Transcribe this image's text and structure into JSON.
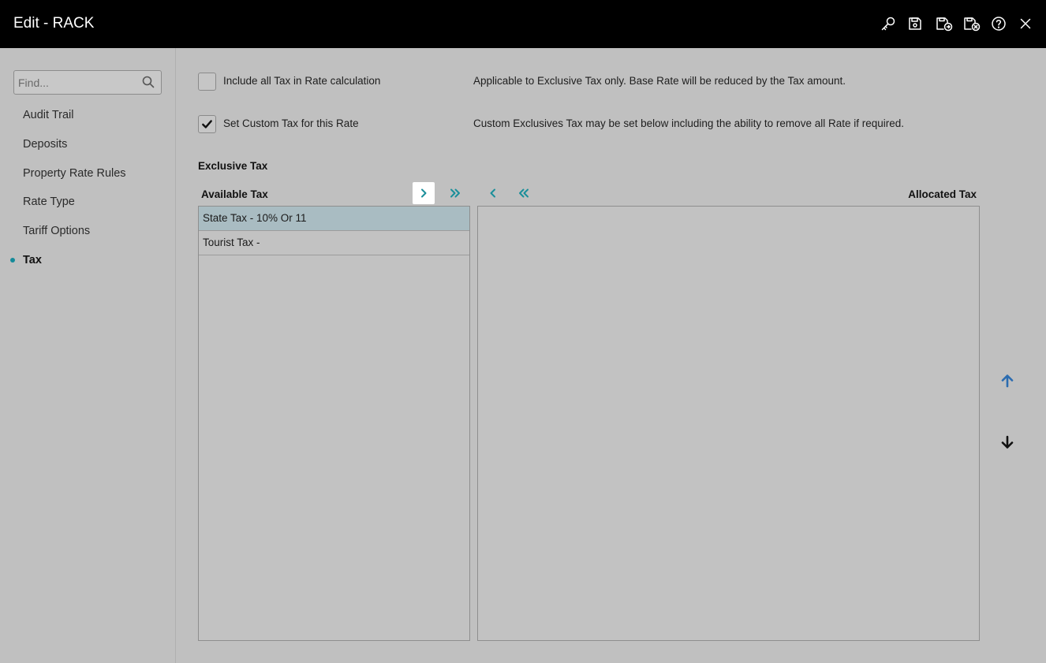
{
  "window": {
    "title": "Edit - RACK"
  },
  "toolbar_icons": [
    "key-icon",
    "save-icon",
    "save-exit-icon",
    "save-close-icon",
    "help-icon",
    "close-icon"
  ],
  "sidebar": {
    "search_placeholder": "Find...",
    "items": [
      {
        "label": "Audit Trail",
        "active": false
      },
      {
        "label": "Deposits",
        "active": false
      },
      {
        "label": "Property Rate Rules",
        "active": false
      },
      {
        "label": "Rate Type",
        "active": false
      },
      {
        "label": "Tariff Options",
        "active": false
      },
      {
        "label": "Tax",
        "active": true
      }
    ]
  },
  "options": [
    {
      "label": "Include all Tax in Rate calculation",
      "checked": false,
      "description": "Applicable to Exclusive Tax only. Base Rate will be reduced by the Tax amount."
    },
    {
      "label": "Set Custom Tax for this Rate",
      "checked": true,
      "description": "Custom Exclusives Tax may be set below including the ability to remove all Rate if required."
    }
  ],
  "exclusive_tax": {
    "section_title": "Exclusive Tax",
    "available_header": "Available Tax",
    "allocated_header": "Allocated Tax",
    "available_items": [
      {
        "label": "State Tax - 10% Or 11",
        "selected": true
      },
      {
        "label": "Tourist Tax -",
        "selected": false
      }
    ],
    "allocated_items": []
  },
  "colors": {
    "accent": "#1a8f9a",
    "move_up": "#2b6cb0",
    "move_down": "#111111",
    "selected_row": "#a9bcc2"
  }
}
